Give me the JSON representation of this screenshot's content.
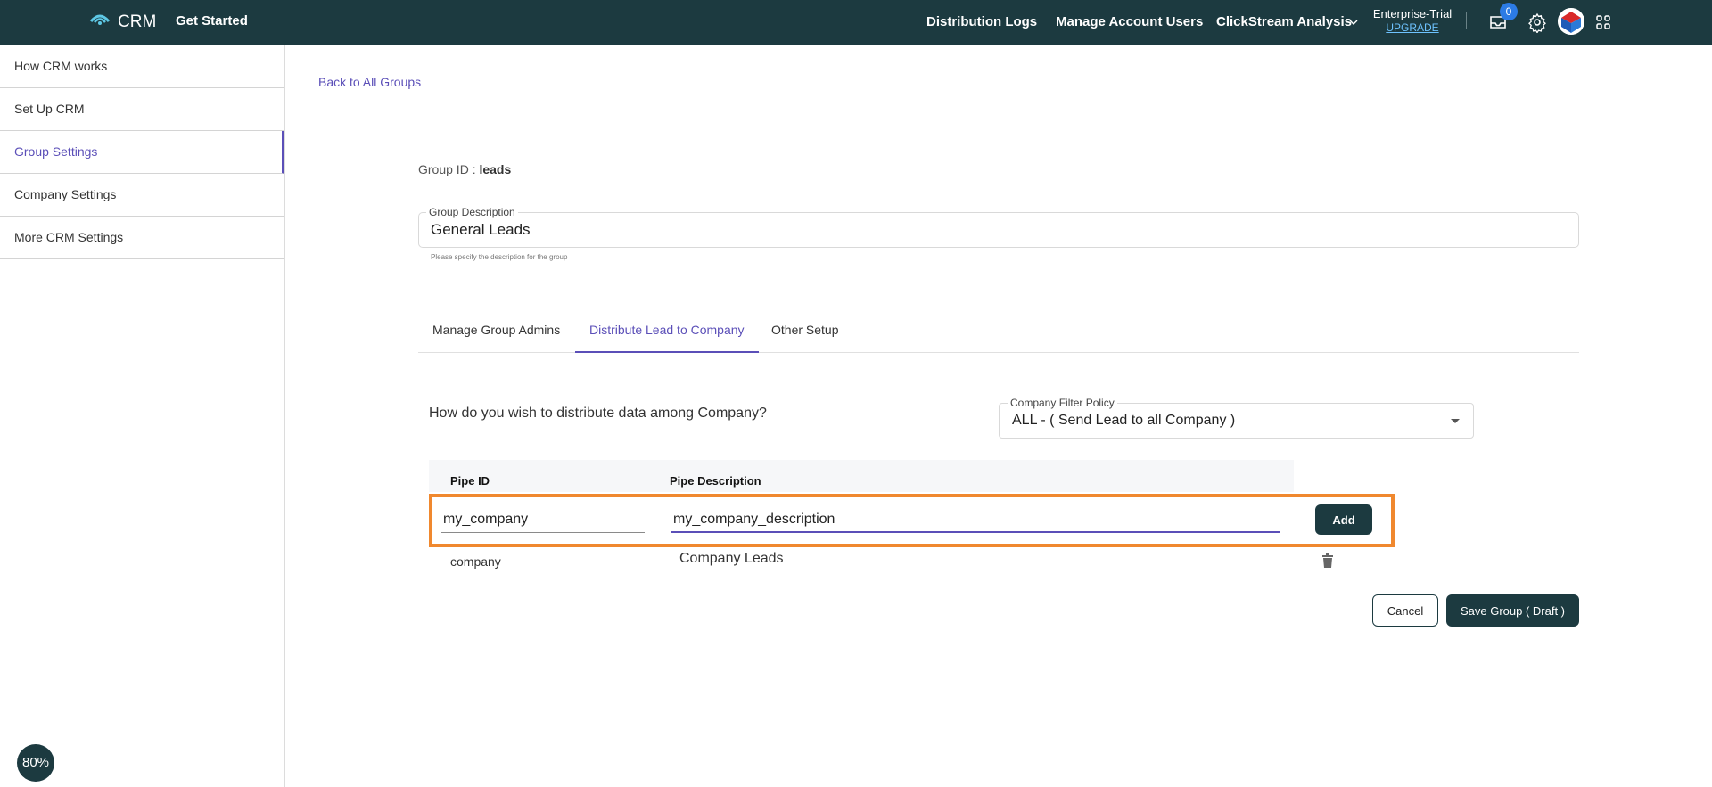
{
  "header": {
    "app_name": "CRM",
    "get_started": "Get Started",
    "nav": [
      "Distribution Logs",
      "Manage Account Users",
      "ClickStream Analysis"
    ],
    "plan_name": "Enterprise-Trial",
    "upgrade": "UPGRADE",
    "inbox_count": "0",
    "icons": [
      "logo-icon",
      "chevron-down-icon",
      "inbox-icon",
      "gear-icon",
      "avatar",
      "apps-grid-icon"
    ],
    "accent": "#1c3a40"
  },
  "sidebar": {
    "items": [
      {
        "label": "How CRM works",
        "active": false
      },
      {
        "label": "Set Up CRM",
        "active": false
      },
      {
        "label": "Group Settings",
        "active": true
      },
      {
        "label": "Company Settings",
        "active": false
      },
      {
        "label": "More CRM Settings",
        "active": false
      }
    ],
    "zoom": "80%"
  },
  "main": {
    "back_link": "Back to All Groups",
    "group_id_label": "Group ID : ",
    "group_id_value": "leads",
    "description": {
      "label": "Group Description",
      "value": "General Leads",
      "help": "Please specify the description for the group"
    },
    "tabs": [
      {
        "label": "Manage Group Admins",
        "active": false
      },
      {
        "label": "Distribute Lead to Company",
        "active": true
      },
      {
        "label": "Other Setup",
        "active": false
      }
    ],
    "question": "How do you wish to distribute data among Company?",
    "filter_policy": {
      "label": "Company Filter Policy",
      "value": "ALL - ( Send Lead to all Company )"
    },
    "table": {
      "columns": [
        "Pipe ID",
        "Pipe Description"
      ],
      "new_row": {
        "pipe_id": "my_company",
        "pipe_description": "my_company_description",
        "add_label": "Add"
      },
      "rows": [
        {
          "pipe_id": "company",
          "pipe_description": "Company Leads"
        }
      ]
    },
    "actions": {
      "cancel": "Cancel",
      "save": "Save Group ( Draft )"
    },
    "highlight_color": "#f0882e",
    "link_color": "#5b4fb8"
  }
}
